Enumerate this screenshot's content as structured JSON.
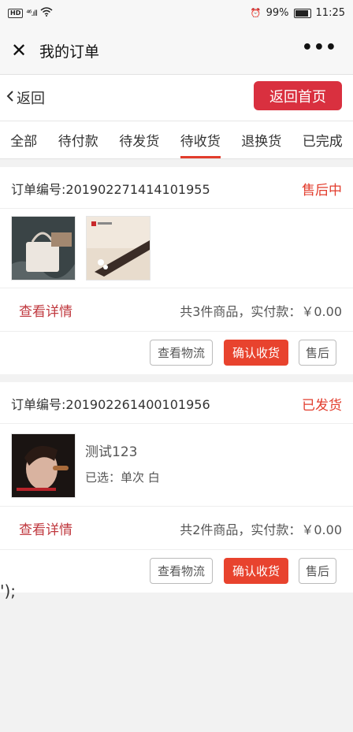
{
  "status_bar": {
    "hd": "HD",
    "signal": "⁴⁶.ıll",
    "battery_pct": "99%",
    "time": "11:25",
    "alarm": "⏰"
  },
  "title_bar": {
    "close": "✕",
    "title": "我的订单",
    "more": "•••"
  },
  "nav": {
    "back": "返回",
    "home": "返回首页"
  },
  "tabs": [
    {
      "label": "全部"
    },
    {
      "label": "待付款"
    },
    {
      "label": "待发货"
    },
    {
      "label": "待收货"
    },
    {
      "label": "退换货"
    },
    {
      "label": "已完成"
    }
  ],
  "orders": [
    {
      "number": "订单编号:201902271414101955",
      "status": "售后中",
      "detail_link": "查看详情",
      "summary": "共3件商品，实付款：￥0.00",
      "btn_logistics": "查看物流",
      "btn_confirm": "确认收货",
      "btn_after_sale": "售后"
    },
    {
      "number": "订单编号:201902261400101956",
      "status": "已发货",
      "product_name": "测试123",
      "product_spec": "已选：单次 白",
      "detail_link": "查看详情",
      "summary": "共2件商品，实付款：￥0.00",
      "btn_logistics": "查看物流",
      "btn_confirm": "确认收货",
      "btn_after_sale": "售后"
    }
  ],
  "stray_text": "');",
  "colors": {
    "accent_red": "#e23c2c",
    "home_btn": "#d9303f",
    "link_red": "#c0393f"
  }
}
